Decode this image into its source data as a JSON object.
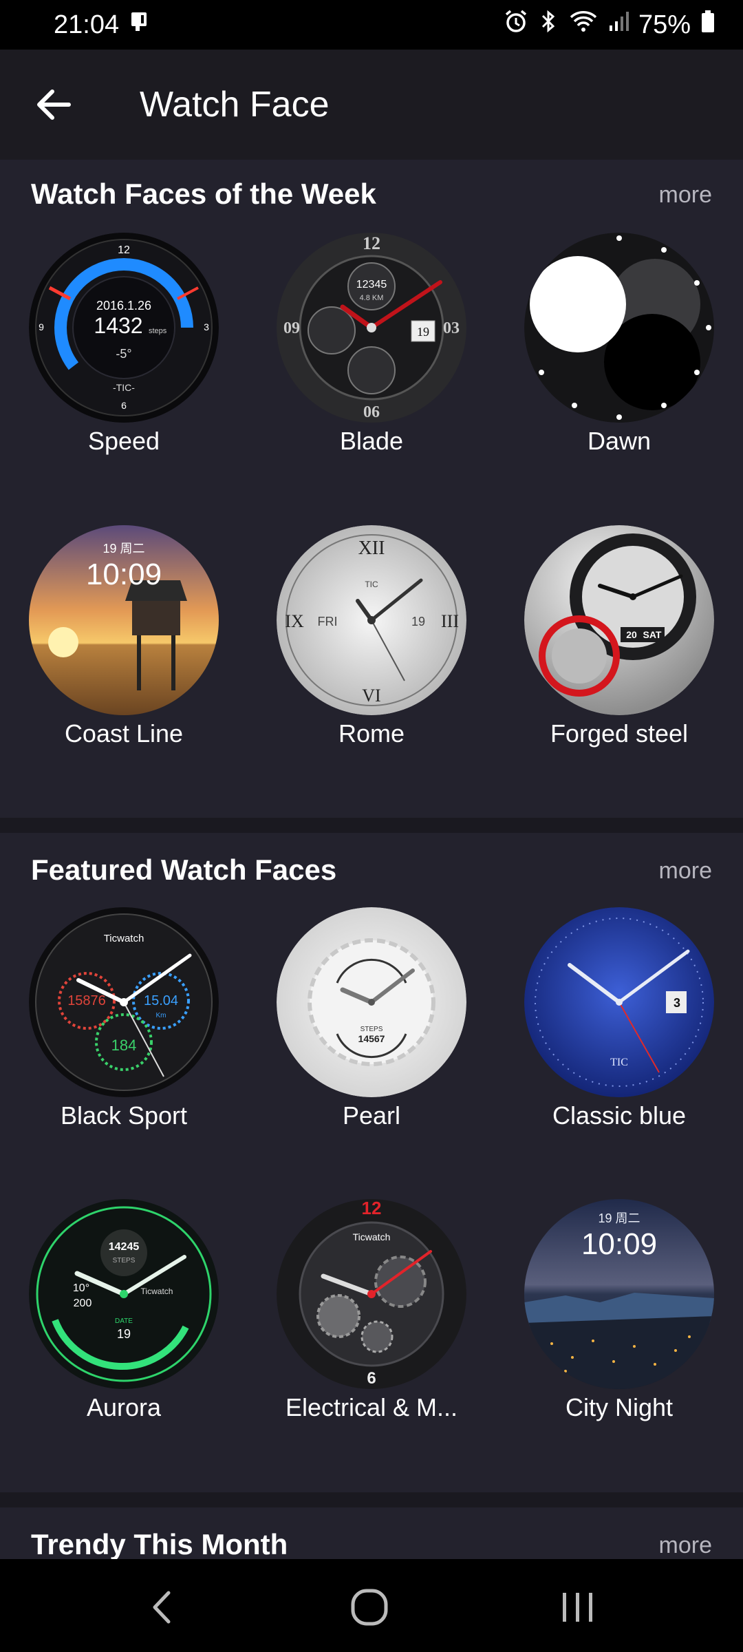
{
  "status": {
    "time": "21:04",
    "battery": "75%",
    "icons": [
      "notification-icon",
      "alarm-icon",
      "bluetooth-icon",
      "wifi-icon",
      "signal-icon",
      "battery-icon"
    ]
  },
  "appbar": {
    "title": "Watch Face",
    "back_icon": "arrow-left-icon"
  },
  "sections": [
    {
      "title": "Watch Faces of the Week",
      "more": "more",
      "items": [
        {
          "name": "Speed"
        },
        {
          "name": "Blade"
        },
        {
          "name": "Dawn"
        },
        {
          "name": "Coast Line"
        },
        {
          "name": "Rome"
        },
        {
          "name": "Forged steel"
        }
      ]
    },
    {
      "title": "Featured Watch Faces",
      "more": "more",
      "items": [
        {
          "name": "Black Sport"
        },
        {
          "name": "Pearl"
        },
        {
          "name": "Classic blue"
        },
        {
          "name": "Aurora"
        },
        {
          "name": "Electrical & M..."
        },
        {
          "name": "City Night"
        }
      ]
    },
    {
      "title": "Trendy This Month",
      "more": "more"
    }
  ],
  "face_text": {
    "speed": {
      "date": "2016.1.26",
      "steps": "1432",
      "steps_unit": "steps",
      "temp": "-5°",
      "brand": "-TIC-"
    },
    "blade": {
      "steps": "12345",
      "distance": "4.8 KM",
      "day": "19"
    },
    "coast_line": {
      "date": "19 周二",
      "time": "10:09"
    },
    "rome": {
      "brand": "TIC",
      "weekday": "FRI",
      "day": "19"
    },
    "forged_steel": {
      "day": "20",
      "weekday": "SAT"
    },
    "black_sport": {
      "brand": "Ticwatch",
      "left_value": "15876",
      "right_value": "15.04",
      "right_unit": "Km",
      "bottom_value": "184"
    },
    "pearl": {
      "steps_label": "STEPS",
      "steps": "14567"
    },
    "classic_blue": {
      "day": "3",
      "brand": "TIC"
    },
    "aurora": {
      "steps": "14245",
      "steps_label": "STEPS",
      "temp": "10°",
      "aqi": "200",
      "brand": "Ticwatch",
      "date_label": "DATE",
      "date": "19"
    },
    "electrical": {
      "brand": "Ticwatch"
    },
    "city_night": {
      "date": "19 周二",
      "time": "10:09"
    }
  },
  "navbar": {
    "icons": [
      "back-nav-icon",
      "home-nav-icon",
      "recents-nav-icon"
    ]
  }
}
